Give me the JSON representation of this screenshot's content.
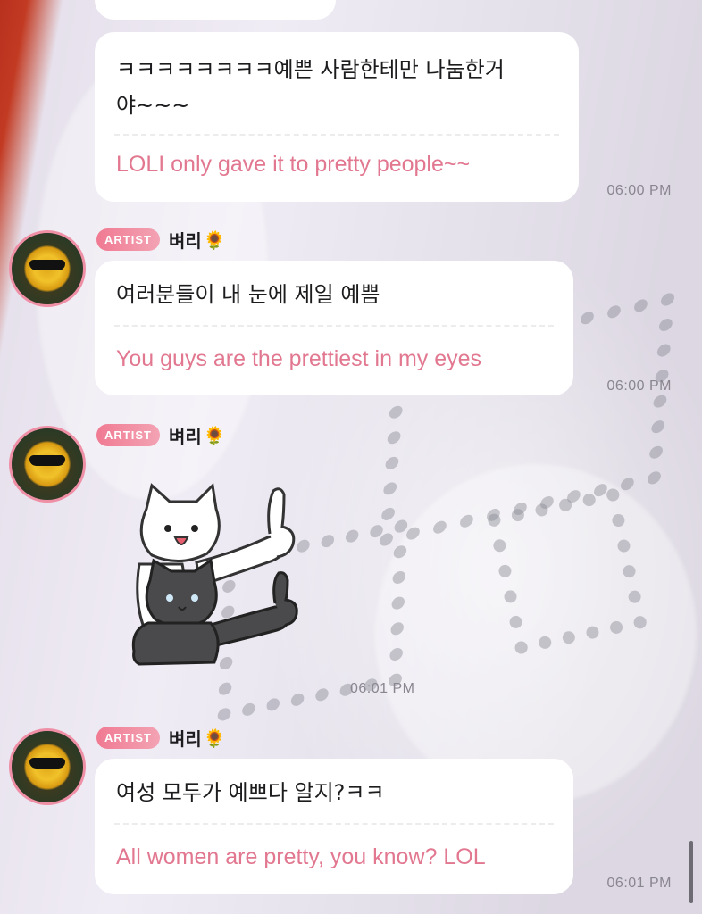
{
  "messages": [
    {
      "ko": "ㅋㅋㅋㅋㅋㅋㅋㅋ예쁜 사람한테만 나눔한거 야~~~",
      "ko_line1": "ㅋㅋㅋㅋㅋㅋㅋㅋ예쁜 사람한테만 나눔한거",
      "ko_line2": "야~~~",
      "en": "LOLI only gave it to pretty people~~",
      "time": "06:00 PM"
    },
    {
      "badge": "ARTIST",
      "sender": "벼리",
      "sender_emoji": "🌻",
      "ko": "여러분들이 내 눈에 제일 예쁨",
      "en": "You guys are the prettiest in my eyes",
      "time": "06:00 PM"
    },
    {
      "badge": "ARTIST",
      "sender": "벼리",
      "sender_emoji": "🌻",
      "sticker": "two-cats-thumbs-up",
      "time": "06:01 PM"
    },
    {
      "badge": "ARTIST",
      "sender": "벼리",
      "sender_emoji": "🌻",
      "ko": "여성 모두가 예쁘다 알지?ㅋㅋ",
      "en": "All women are pretty, you know? LOL",
      "time": "06:01 PM"
    }
  ],
  "colors": {
    "badge": "#f07a92",
    "translation_text": "#e27790",
    "avatar_ring": "#ef8fa6",
    "bubble": "#ffffff"
  }
}
